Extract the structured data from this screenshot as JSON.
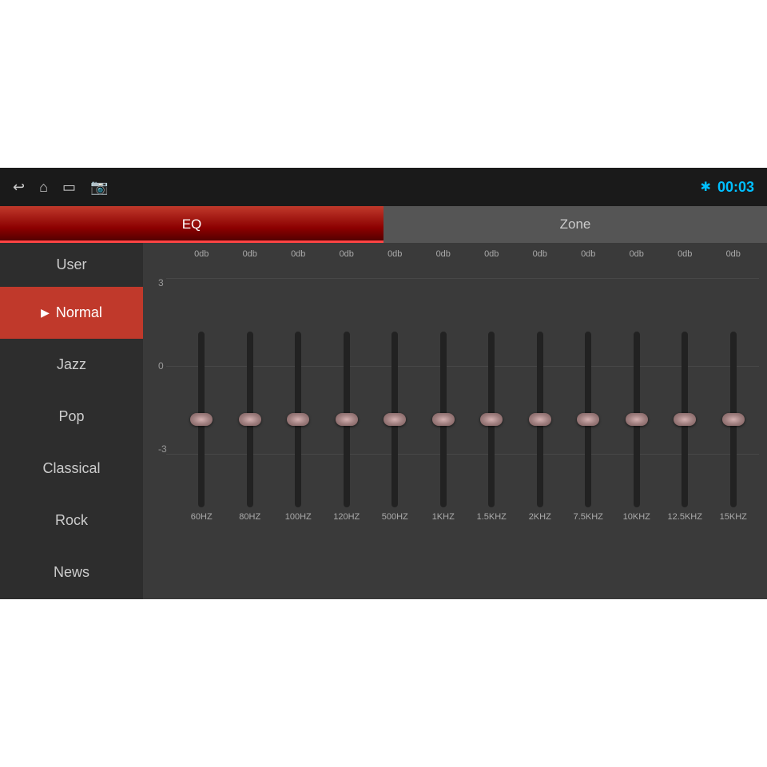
{
  "topbar": {
    "timer": "00:03",
    "icons": [
      "back",
      "home",
      "window",
      "image"
    ]
  },
  "tabs": [
    {
      "label": "EQ",
      "active": true
    },
    {
      "label": "Zone",
      "active": false
    }
  ],
  "sidebar": {
    "items": [
      {
        "label": "User",
        "active": false,
        "id": "user"
      },
      {
        "label": "Normal",
        "active": true,
        "id": "normal"
      },
      {
        "label": "Jazz",
        "active": false,
        "id": "jazz"
      },
      {
        "label": "Pop",
        "active": false,
        "id": "pop"
      },
      {
        "label": "Classical",
        "active": false,
        "id": "classical"
      },
      {
        "label": "Rock",
        "active": false,
        "id": "rock"
      },
      {
        "label": "News",
        "active": false,
        "id": "news"
      }
    ]
  },
  "eq": {
    "scale": {
      "top": "3",
      "mid": "0",
      "bot": "-3"
    },
    "bands": [
      {
        "hz": "60HZ",
        "db": "0db",
        "value": 0
      },
      {
        "hz": "80HZ",
        "db": "0db",
        "value": 0
      },
      {
        "hz": "100HZ",
        "db": "0db",
        "value": 0
      },
      {
        "hz": "120HZ",
        "db": "0db",
        "value": 0
      },
      {
        "hz": "500HZ",
        "db": "0db",
        "value": 0
      },
      {
        "hz": "1KHZ",
        "db": "0db",
        "value": 0
      },
      {
        "hz": "1.5KHZ",
        "db": "0db",
        "value": 0
      },
      {
        "hz": "2KHZ",
        "db": "0db",
        "value": 0
      },
      {
        "hz": "7.5KHZ",
        "db": "0db",
        "value": 0
      },
      {
        "hz": "10KHZ",
        "db": "0db",
        "value": 0
      },
      {
        "hz": "12.5KHZ",
        "db": "0db",
        "value": 0
      },
      {
        "hz": "15KHZ",
        "db": "0db",
        "value": 0
      }
    ]
  }
}
